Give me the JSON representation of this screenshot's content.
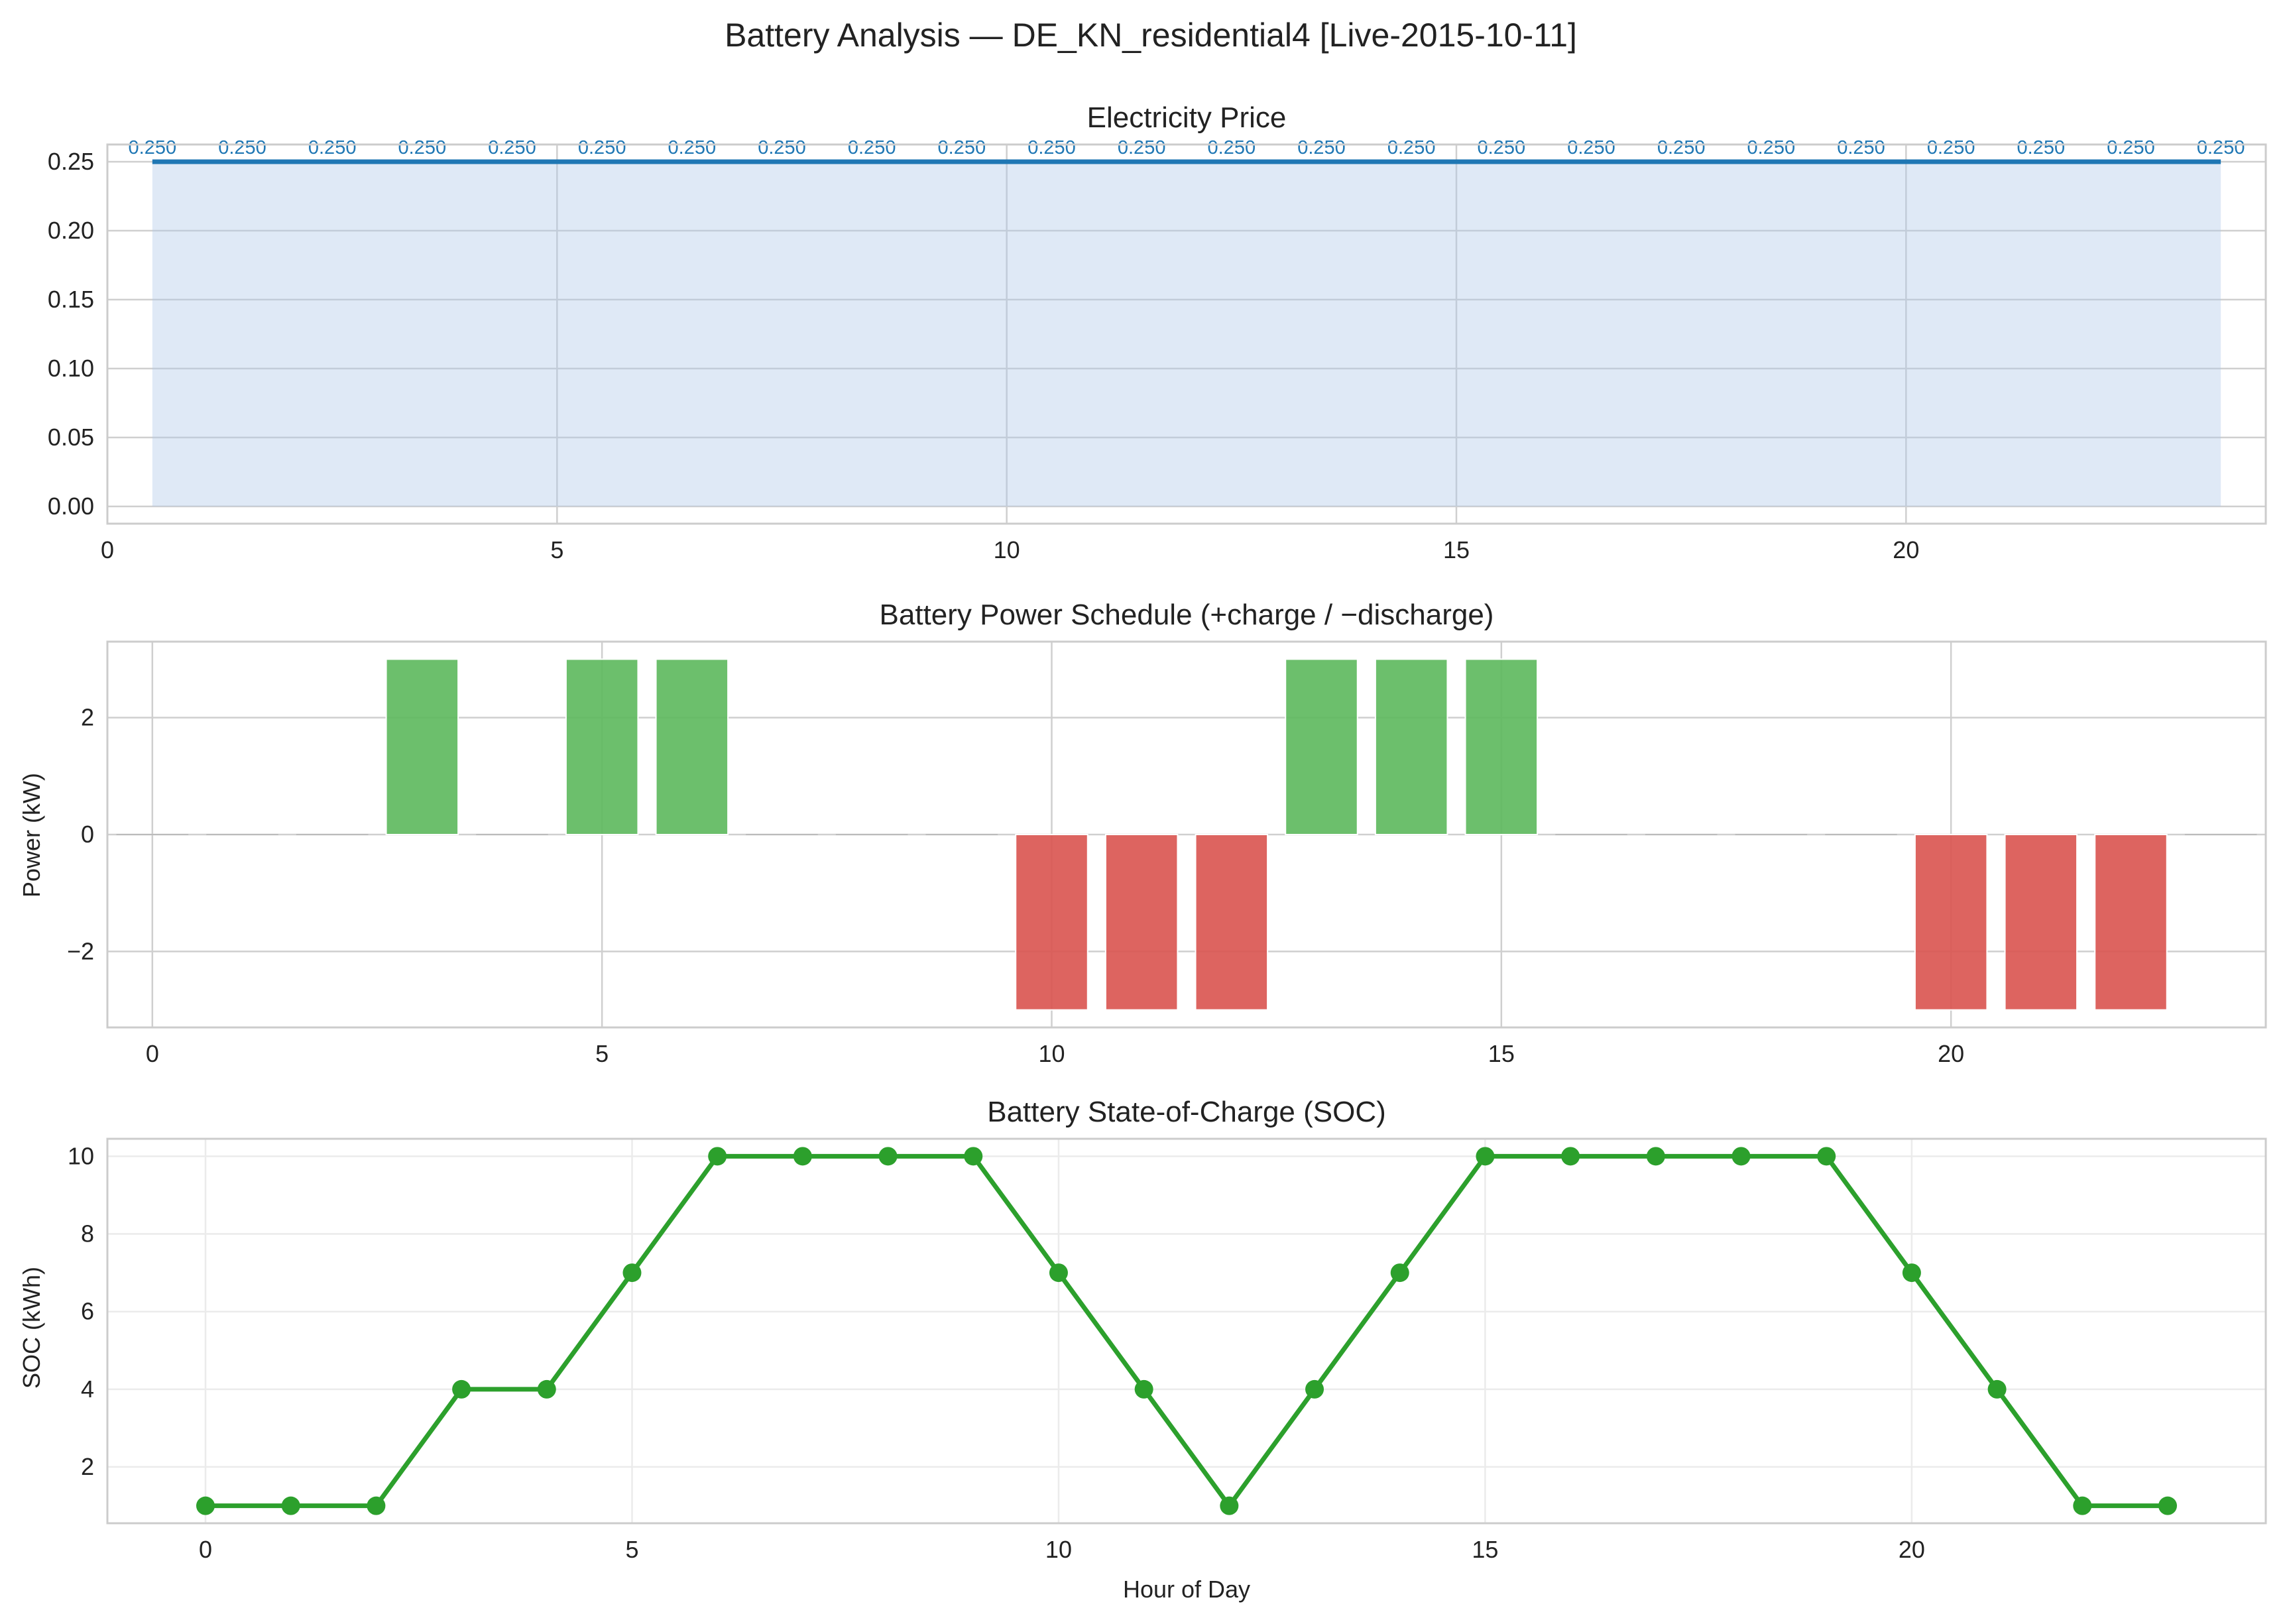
{
  "figure_title": "Battery Analysis — DE_KN_residential4 [Live-2015-10-11]",
  "chart_data": [
    {
      "type": "area",
      "title": "Electricity Price",
      "xlabel": "",
      "ylabel": "",
      "x": [
        0.5,
        1.5,
        2.5,
        3.5,
        4.5,
        5.5,
        6.5,
        7.5,
        8.5,
        9.5,
        10.5,
        11.5,
        12.5,
        13.5,
        14.5,
        15.5,
        16.5,
        17.5,
        18.5,
        19.5,
        20.5,
        21.5,
        22.5,
        23.5
      ],
      "values": [
        0.25,
        0.25,
        0.25,
        0.25,
        0.25,
        0.25,
        0.25,
        0.25,
        0.25,
        0.25,
        0.25,
        0.25,
        0.25,
        0.25,
        0.25,
        0.25,
        0.25,
        0.25,
        0.25,
        0.25,
        0.25,
        0.25,
        0.25,
        0.25
      ],
      "data_labels": [
        "0.250",
        "0.250",
        "0.250",
        "0.250",
        "0.250",
        "0.250",
        "0.250",
        "0.250",
        "0.250",
        "0.250",
        "0.250",
        "0.250",
        "0.250",
        "0.250",
        "0.250",
        "0.250",
        "0.250",
        "0.250",
        "0.250",
        "0.250",
        "0.250",
        "0.250",
        "0.250",
        "0.250"
      ],
      "xlim": [
        0,
        24
      ],
      "ylim": [
        -0.0125,
        0.2625
      ],
      "xticks": [
        0,
        5,
        10,
        15,
        20
      ],
      "yticks": [
        0.0,
        0.05,
        0.1,
        0.15,
        0.2,
        0.25
      ],
      "ytick_labels": [
        "0.00",
        "0.05",
        "0.10",
        "0.15",
        "0.20",
        "0.25"
      ],
      "grid": true,
      "colors": {
        "line": "#1f77b4",
        "fill": "#aec7e8"
      }
    },
    {
      "type": "bar",
      "title": "Battery Power Schedule (+charge / −discharge)",
      "xlabel": "",
      "ylabel": "Power (kW)",
      "x": [
        0,
        1,
        2,
        3,
        4,
        5,
        6,
        7,
        8,
        9,
        10,
        11,
        12,
        13,
        14,
        15,
        16,
        17,
        18,
        19,
        20,
        21,
        22,
        23
      ],
      "values": [
        0,
        0,
        0,
        3,
        0,
        3,
        3,
        0,
        0,
        0,
        -3,
        -3,
        -3,
        3,
        3,
        3,
        0,
        0,
        0,
        0,
        -3,
        -3,
        -3,
        0
      ],
      "xlim": [
        -0.5,
        23.5
      ],
      "ylim": [
        -3.3,
        3.3
      ],
      "xticks": [
        0,
        5,
        10,
        15,
        20
      ],
      "yticks": [
        -2,
        0,
        2
      ],
      "ytick_labels": [
        "−2",
        "0",
        "2"
      ],
      "grid": true,
      "colors": {
        "charge": "#5cb85c",
        "discharge": "#d9534f"
      }
    },
    {
      "type": "line",
      "title": "Battery State-of-Charge (SOC)",
      "xlabel": "Hour of Day",
      "ylabel": "SOC (kWh)",
      "x": [
        0,
        1,
        2,
        3,
        4,
        5,
        6,
        7,
        8,
        9,
        10,
        11,
        12,
        13,
        14,
        15,
        16,
        17,
        18,
        19,
        20,
        21,
        22,
        23
      ],
      "values": [
        1,
        1,
        1,
        4,
        4,
        7,
        10,
        10,
        10,
        10,
        7,
        4,
        1,
        4,
        7,
        10,
        10,
        10,
        10,
        10,
        7,
        4,
        1,
        1
      ],
      "xlim": [
        -1.15,
        24.15
      ],
      "ylim": [
        0.55,
        10.45
      ],
      "xticks": [
        0,
        5,
        10,
        15,
        20
      ],
      "yticks": [
        2,
        4,
        6,
        8,
        10
      ],
      "grid": true,
      "colors": {
        "line": "#2ca02c"
      }
    }
  ]
}
